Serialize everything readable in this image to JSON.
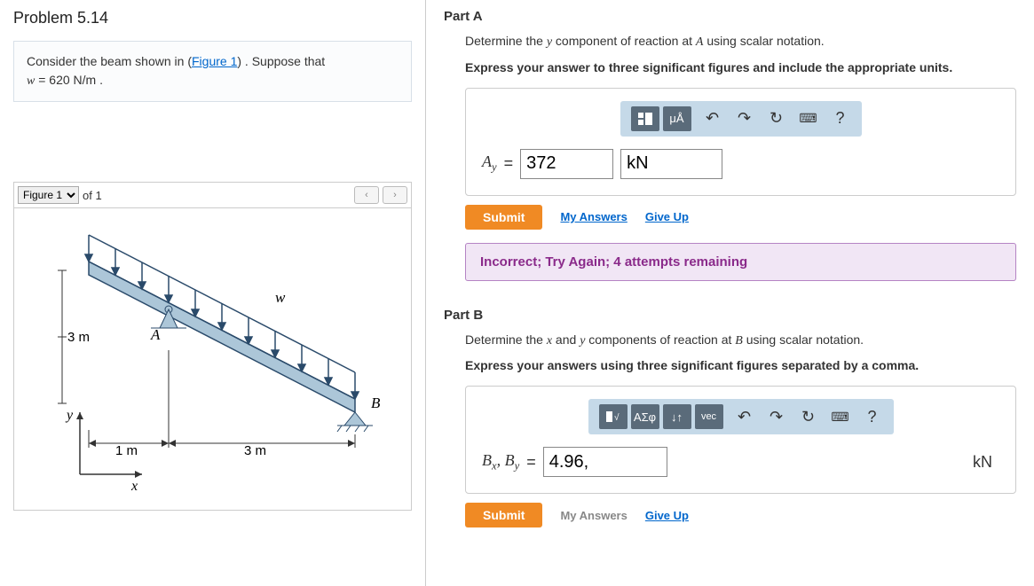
{
  "problem": {
    "title": "Problem 5.14",
    "context_prefix": "Consider the beam shown in (",
    "figure_link": "Figure 1",
    "context_middle": ") . Suppose that ",
    "w_label": "w",
    "w_value": " = 620  N/m .",
    "figure_select": "Figure 1",
    "figure_of": "of 1"
  },
  "partA": {
    "title": "Part A",
    "instr_pre": "Determine the ",
    "instr_var": "y",
    "instr_mid": " component of reaction at ",
    "instr_point": "A",
    "instr_post": " using scalar notation.",
    "bold_instr": "Express your answer to three significant figures and include the appropriate units.",
    "var_html": "A",
    "sub": "y",
    "value": "372",
    "unit": "kN",
    "submit": "Submit",
    "my_answers": "My Answers",
    "give_up": "Give Up",
    "feedback": "Incorrect; Try Again; 4 attempts remaining",
    "toolbar": {
      "units": "μÅ",
      "help": "?"
    }
  },
  "partB": {
    "title": "Part B",
    "instr_pre": "Determine the ",
    "instr_var1": "x",
    "instr_and": " and ",
    "instr_var2": "y",
    "instr_mid": " components of reaction at ",
    "instr_point": "B",
    "instr_post": " using scalar notation.",
    "bold_instr": "Express your answers using three significant figures separated by a comma.",
    "var_label": "B",
    "value": "4.96,",
    "unit_suffix": "kN",
    "submit": "Submit",
    "my_answers": "My Answers",
    "give_up": "Give Up",
    "toolbar": {
      "sigma": "ΑΣφ",
      "vec": "vec",
      "help": "?"
    }
  },
  "figure": {
    "labels": {
      "w": "w",
      "A": "A",
      "B": "B",
      "x": "x",
      "y": "y",
      "3m": "3 m",
      "1m": "1 m",
      "3m_h": "3 m"
    }
  }
}
